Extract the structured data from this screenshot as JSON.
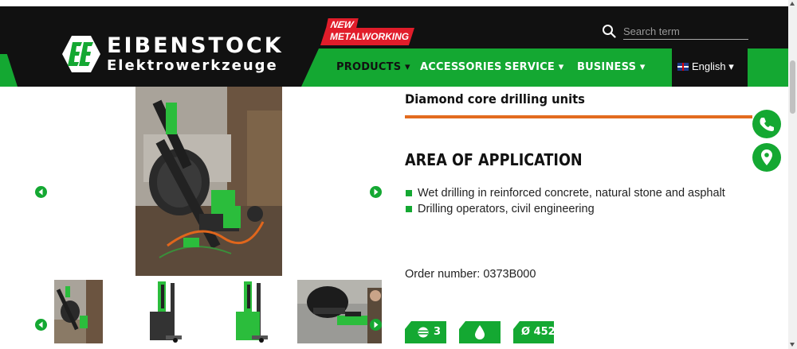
{
  "brand": {
    "name_line1": "EIBENSTOCK",
    "name_line2": "Elektrowerkzeuge",
    "colors": {
      "green": "#14a832",
      "black": "#111111",
      "red": "#e11d2a",
      "orange": "#e36b1f"
    }
  },
  "badge": {
    "new_label": "NEW",
    "label": "METALWORKING"
  },
  "search": {
    "placeholder": "Search term",
    "value": ""
  },
  "nav": {
    "items": [
      {
        "label": "PRODUCTS ▾",
        "active": true
      },
      {
        "label": "ACCESSORIES",
        "active": false
      },
      {
        "label": "SERVICE ▾",
        "active": false
      },
      {
        "label": "BUSINESS ▾",
        "active": false
      }
    ],
    "language": "English ▾"
  },
  "product": {
    "title": "Diamond core drilling units",
    "section_title": "AREA OF APPLICATION",
    "bullets": [
      "Wet drilling in reinforced concrete, natural stone and asphalt",
      "Drilling operators, civil engineering"
    ],
    "order_number": "Order number: 0373B000",
    "chips": [
      {
        "icon": "gear-speed-icon",
        "value": "3"
      },
      {
        "icon": "water-drop-icon",
        "value": ""
      },
      {
        "icon": "diameter-icon",
        "value": "Ø 452"
      }
    ]
  },
  "gallery": {
    "thumbnails": [
      "thumbnail-1",
      "thumbnail-2",
      "thumbnail-3",
      "thumbnail-4"
    ],
    "arrow_icons": [
      "arrow-left-icon",
      "arrow-right-icon"
    ]
  },
  "floating": {
    "icons": [
      "phone-icon",
      "location-pin-icon"
    ]
  }
}
